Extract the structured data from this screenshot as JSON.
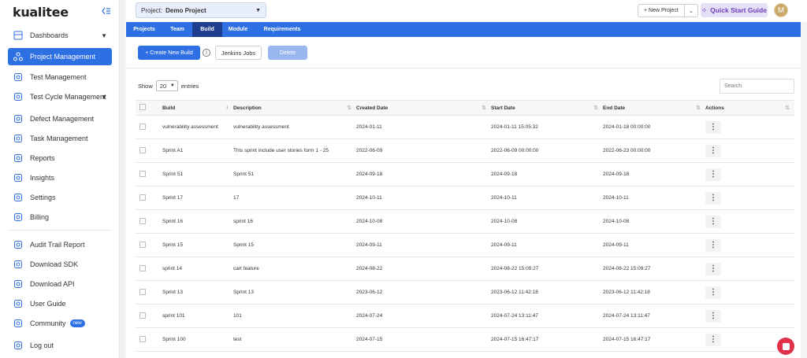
{
  "brand": {
    "logo": "kualitee"
  },
  "sidebar": {
    "items": [
      {
        "label": "Dashboards",
        "icon": "dashboard-icon",
        "has_caret": true
      },
      {
        "label": "Project Management",
        "icon": "project-icon",
        "active": true
      },
      {
        "label": "Test Management",
        "icon": "test-icon"
      },
      {
        "label": "Test Cycle Management",
        "icon": "cycle-icon",
        "has_caret": true
      },
      {
        "label": "Defect Management",
        "icon": "defect-icon"
      },
      {
        "label": "Task Management",
        "icon": "task-icon"
      },
      {
        "label": "Reports",
        "icon": "reports-icon"
      },
      {
        "label": "Insights",
        "icon": "insights-icon"
      },
      {
        "label": "Settings",
        "icon": "settings-icon"
      },
      {
        "label": "Billing",
        "icon": "billing-icon"
      },
      {
        "label": "Audit Trail Report",
        "icon": "audit-icon"
      },
      {
        "label": "Download SDK",
        "icon": "sdk-icon"
      },
      {
        "label": "Download API",
        "icon": "api-icon"
      },
      {
        "label": "User Guide",
        "icon": "guide-icon"
      },
      {
        "label": "Community",
        "icon": "community-icon",
        "badge": "new"
      },
      {
        "label": "Log out",
        "icon": "logout-icon"
      }
    ]
  },
  "topbar": {
    "project_label": "Project:",
    "project_value": "Demo Project",
    "new_project": "+  New Project",
    "quick_start": "Quick Start Guide",
    "avatar_initial": "M"
  },
  "tabs": [
    {
      "label": "Projects"
    },
    {
      "label": "Team"
    },
    {
      "label": "Build",
      "active": true
    },
    {
      "label": "Module"
    },
    {
      "label": "Requirements"
    }
  ],
  "toolbar": {
    "create": "+ Create New Build",
    "info": "i",
    "jenkins": "Jenkins Jobs",
    "delete": "Delete"
  },
  "list_controls": {
    "show": "Show",
    "entries_value": "20",
    "entries": "entries",
    "search_placeholder": "Search"
  },
  "table": {
    "headers": [
      "Build",
      "Description",
      "Created Date",
      "Start Date",
      "End Date",
      "Actions"
    ],
    "rows": [
      [
        "vulnerability assessment",
        "vulnerability assessment",
        "2024-01-11",
        "2024-01-11 15:05:32",
        "2024-01-18 00:00:00"
      ],
      [
        "Sprint A1",
        "This sprint include user stories form 1 - 25",
        "2022-06-09",
        "2022-06-09 00:00:00",
        "2022-06-23 00:00:00"
      ],
      [
        "Sprint 51",
        "Sprint 51",
        "2024-09-18",
        "2024-09-18",
        "2024-09-18"
      ],
      [
        "Sprint 17",
        "17",
        "2024-10-11",
        "2024-10-11",
        "2024-10-11"
      ],
      [
        "Sprint 16",
        "sprint 16",
        "2024-10-08",
        "2024-10-08",
        "2024-10-08"
      ],
      [
        "Sprint 15",
        "Sprint 15",
        "2024-09-11",
        "2024-09-11",
        "2024-09-11"
      ],
      [
        "sprint 14",
        "cart feature",
        "2024-08-22",
        "2024-08-22 15:09:27",
        "2024-08-22 15:09:27"
      ],
      [
        "Sprint 13",
        "Sprint 13",
        "2023-06-12",
        "2023-06-12 11:42:18",
        "2023-06-12 11:42:18"
      ],
      [
        "sprint 101",
        "101",
        "2024-07-24",
        "2024-07-24 13:11:47",
        "2024-07-24 13:11:47"
      ],
      [
        "Sprint 100",
        "test",
        "2024-07-15",
        "2024-07-15 16:47:17",
        "2024-07-15 16:47:17"
      ]
    ]
  },
  "colors": {
    "primary": "#2f6fe4",
    "tab_active": "#1e3d8f",
    "quick_start_bg": "#e6e0f7",
    "chat": "#e0314b"
  }
}
